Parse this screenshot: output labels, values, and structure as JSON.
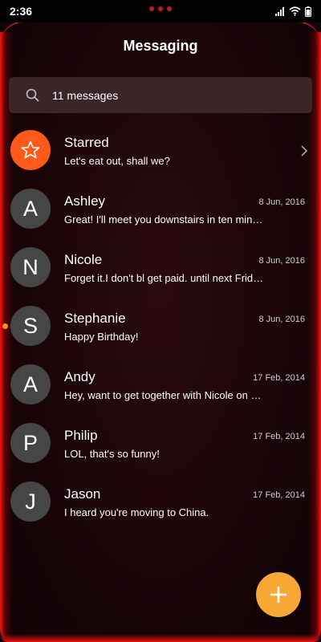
{
  "status_bar": {
    "time": "2:36"
  },
  "header": {
    "title": "Messaging"
  },
  "search": {
    "placeholder": "11 messages"
  },
  "starred": {
    "label": "Starred",
    "preview": "Let's eat out, shall we?"
  },
  "conversations": [
    {
      "initial": "A",
      "name": "Ashley",
      "date": "8 Jun, 2016",
      "preview": "Great! I'll meet you downstairs in ten min…",
      "unread": false
    },
    {
      "initial": "N",
      "name": "Nicole",
      "date": "8 Jun, 2016",
      "preview": "Forget it.I don't bl get paid. until next Frid…",
      "unread": false
    },
    {
      "initial": "S",
      "name": "Stephanie",
      "date": "8 Jun, 2016",
      "preview": "Happy Birthday!",
      "unread": true
    },
    {
      "initial": "A",
      "name": "Andy",
      "date": "17 Feb, 2014",
      "preview": "Hey, want to get together with Nicole on …",
      "unread": false
    },
    {
      "initial": "P",
      "name": "Philip",
      "date": "17 Feb, 2014",
      "preview": "LOL, that's so funny!",
      "unread": false
    },
    {
      "initial": "J",
      "name": "Jason",
      "date": "17 Feb, 2014",
      "preview": "I heard you're moving to China.",
      "unread": false
    }
  ],
  "icons": {
    "search": "search-icon",
    "star": "star-icon",
    "chevron": "chevron-right-icon",
    "add": "plus-icon",
    "signal": "signal-icon",
    "wifi": "wifi-icon",
    "battery": "battery-icon"
  },
  "colors": {
    "accent_fab": "#f7a733",
    "starred_avatar": "#ff5a1a",
    "unread_dot": "#ff8a1e",
    "avatar_bg": "#464646",
    "glow": "#ff1414"
  }
}
